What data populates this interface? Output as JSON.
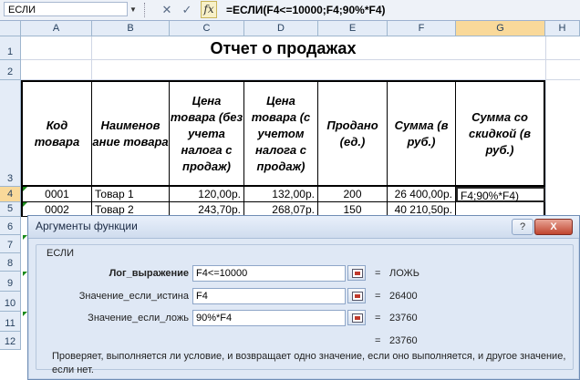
{
  "formula_bar": {
    "name_box": "ЕСЛИ",
    "cancel_symbol": "✕",
    "enter_symbol": "✓",
    "fx_label": "fx",
    "formula": "=ЕСЛИ(F4<=10000;F4;90%*F4)"
  },
  "columns": [
    "A",
    "B",
    "C",
    "D",
    "E",
    "F",
    "G",
    "H"
  ],
  "rows": [
    "1",
    "2",
    "3",
    "4",
    "5",
    "6",
    "7",
    "8",
    "9",
    "10",
    "11",
    "12"
  ],
  "sheet": {
    "title": "Отчет о продажах",
    "headers": [
      "Код товара",
      "Наименов ание товара",
      "Цена товара (без учета налога с продаж)",
      "Цена товара (с учетом налога с продаж)",
      "Продано (ед.)",
      "Сумма (в руб.)",
      "Сумма со скидкой (в руб.)"
    ],
    "row4": [
      "0001",
      "Товар 1",
      "120,00р.",
      "132,00р.",
      "200",
      "26 400,00р.",
      "F4;90%*F4)"
    ],
    "row5": [
      "0002",
      "Товар 2",
      "243,70р.",
      "268,07р.",
      "150",
      "40 210,50р."
    ]
  },
  "dialog": {
    "title": "Аргументы функции",
    "help_label": "?",
    "close_label": "X",
    "function_name": "ЕСЛИ",
    "args": [
      {
        "label": "Лог_выражение",
        "value": "F4<=10000",
        "result": "ЛОЖЬ"
      },
      {
        "label": "Значение_если_истина",
        "value": "F4",
        "result": "26400"
      },
      {
        "label": "Значение_если_ложь",
        "value": "90%*F4",
        "result": "23760"
      }
    ],
    "equals": "=",
    "total_result": "23760",
    "description": "Проверяет, выполняется ли условие, и возвращает одно значение, если оно выполняется, и другое значение, если нет."
  },
  "colors": {
    "accent": "#f9d99a",
    "grid": "#d0d7e5",
    "header_bg": "#e4ecf7",
    "dialog_bg": "#dfe8f5"
  }
}
